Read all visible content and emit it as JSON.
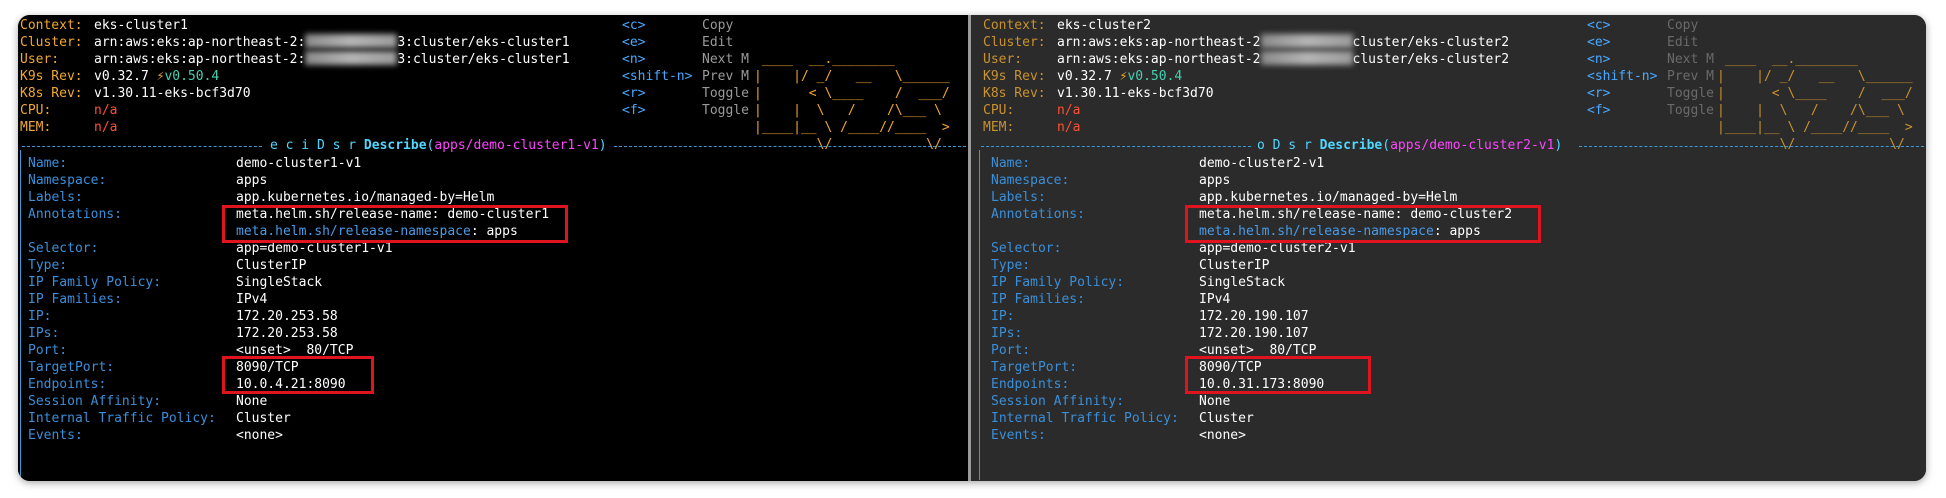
{
  "colors": {
    "accent_red": "#e0141e",
    "label_orange": "#f0a830",
    "key_blue": "#3b8fd9",
    "title_cyan": "#4fd7ff",
    "resource_magenta": "#ff44ff"
  },
  "left": {
    "header": [
      {
        "label": "Context:",
        "value": "eks-cluster1"
      },
      {
        "label": "Cluster:",
        "value_pre": "arn:aws:eks:ap-northeast-2:",
        "value_post": "3:cluster/eks-cluster1"
      },
      {
        "label": "User:",
        "value_pre": "arn:aws:eks:ap-northeast-2:",
        "value_post": "3:cluster/eks-cluster1"
      },
      {
        "label": "K9s Rev:",
        "value": "v0.32.7",
        "bolt": "⚡",
        "extra": "v0.50.4"
      },
      {
        "label": "K8s Rev:",
        "value": "v1.30.11-eks-bcf3d70"
      },
      {
        "label": "CPU:",
        "value": "n/a"
      },
      {
        "label": "MEM:",
        "value": "n/a"
      }
    ],
    "shortcuts": [
      {
        "key": "<c>",
        "action": "Copy"
      },
      {
        "key": "<e>",
        "action": "Edit"
      },
      {
        "key": "<n>",
        "action": "Next M"
      },
      {
        "key": "<shift-n>",
        "action": "Prev M"
      },
      {
        "key": "<r>",
        "action": "Toggle"
      },
      {
        "key": "<f>",
        "action": "Toggle"
      }
    ],
    "logo": [
      " ____  __.________",
      "|    |/ _/   __   \\______",
      "|      < \\____    /  ___/",
      "|    |  \\   /    /\\___ \\",
      "|____|__ \\ /____//____  >",
      "        \\/            \\/"
    ],
    "title": {
      "crumbs": "e c i D s r",
      "label": "Describe",
      "resource": "apps/demo-cluster1-v1"
    },
    "fields": [
      {
        "key": "Name:",
        "value": "demo-cluster1-v1"
      },
      {
        "key": "Namespace:",
        "value": "apps"
      },
      {
        "key": "Labels:",
        "value": "app.kubernetes.io/managed-by=Helm"
      },
      {
        "key": "Annotations:",
        "value": "meta.helm.sh/release-name: demo-cluster1"
      },
      {
        "key": "",
        "subkey": "meta.helm.sh/release-namespace",
        "value": ": apps"
      },
      {
        "key": "Selector:",
        "value": "app=demo-cluster1-v1"
      },
      {
        "key": "Type:",
        "value": "ClusterIP"
      },
      {
        "key": "IP Family Policy:",
        "value": "SingleStack"
      },
      {
        "key": "IP Families:",
        "value": "IPv4"
      },
      {
        "key": "IP:",
        "value": "172.20.253.58"
      },
      {
        "key": "IPs:",
        "value": "172.20.253.58"
      },
      {
        "key": "Port:",
        "value": "<unset>  80/TCP"
      },
      {
        "key": "TargetPort:",
        "value": "8090/TCP"
      },
      {
        "key": "Endpoints:",
        "value": "10.0.4.21:8090"
      },
      {
        "key": "Session Affinity:",
        "value": "None"
      },
      {
        "key": "Internal Traffic Policy:",
        "value": "Cluster"
      },
      {
        "key": "Events:",
        "value": "<none>"
      }
    ]
  },
  "right": {
    "header": [
      {
        "label": "Context:",
        "value": "eks-cluster2"
      },
      {
        "label": "Cluster:",
        "value_pre": "arn:aws:eks:ap-northeast-2",
        "value_post": "cluster/eks-cluster2"
      },
      {
        "label": "User:",
        "value_pre": "arn:aws:eks:ap-northeast-2",
        "value_post": "cluster/eks-cluster2"
      },
      {
        "label": "K9s Rev:",
        "value": "v0.32.7",
        "bolt": "⚡",
        "extra": "v0.50.4"
      },
      {
        "label": "K8s Rev:",
        "value": "v1.30.11-eks-bcf3d70"
      },
      {
        "label": "CPU:",
        "value": "n/a"
      },
      {
        "label": "MEM:",
        "value": "n/a"
      }
    ],
    "shortcuts": [
      {
        "key": "<c>",
        "action": "Copy"
      },
      {
        "key": "<e>",
        "action": "Edit"
      },
      {
        "key": "<n>",
        "action": "Next M"
      },
      {
        "key": "<shift-n>",
        "action": "Prev M"
      },
      {
        "key": "<r>",
        "action": "Toggle"
      },
      {
        "key": "<f>",
        "action": "Toggle"
      }
    ],
    "logo": [
      " ____  __.________",
      "|    |/ _/   __   \\______",
      "|      < \\____    /  ___/",
      "|    |  \\   /    /\\___ \\",
      "|____|__ \\ /____//____  >",
      "        \\/            \\/"
    ],
    "title": {
      "crumbs": "o D s r",
      "label": "Describe",
      "resource": "apps/demo-cluster2-v1"
    },
    "fields": [
      {
        "key": "Name:",
        "value": "demo-cluster2-v1"
      },
      {
        "key": "Namespace:",
        "value": "apps"
      },
      {
        "key": "Labels:",
        "value": "app.kubernetes.io/managed-by=Helm"
      },
      {
        "key": "Annotations:",
        "value": "meta.helm.sh/release-name: demo-cluster2"
      },
      {
        "key": "",
        "subkey": "meta.helm.sh/release-namespace",
        "value": ": apps"
      },
      {
        "key": "Selector:",
        "value": "app=demo-cluster2-v1"
      },
      {
        "key": "Type:",
        "value": "ClusterIP"
      },
      {
        "key": "IP Family Policy:",
        "value": "SingleStack"
      },
      {
        "key": "IP Families:",
        "value": "IPv4"
      },
      {
        "key": "IP:",
        "value": "172.20.190.107"
      },
      {
        "key": "IPs:",
        "value": "172.20.190.107"
      },
      {
        "key": "Port:",
        "value": "<unset>  80/TCP"
      },
      {
        "key": "TargetPort:",
        "value": "8090/TCP"
      },
      {
        "key": "Endpoints:",
        "value": "10.0.31.173:8090"
      },
      {
        "key": "Session Affinity:",
        "value": "None"
      },
      {
        "key": "Internal Traffic Policy:",
        "value": "Cluster"
      },
      {
        "key": "Events:",
        "value": "<none>"
      }
    ]
  }
}
